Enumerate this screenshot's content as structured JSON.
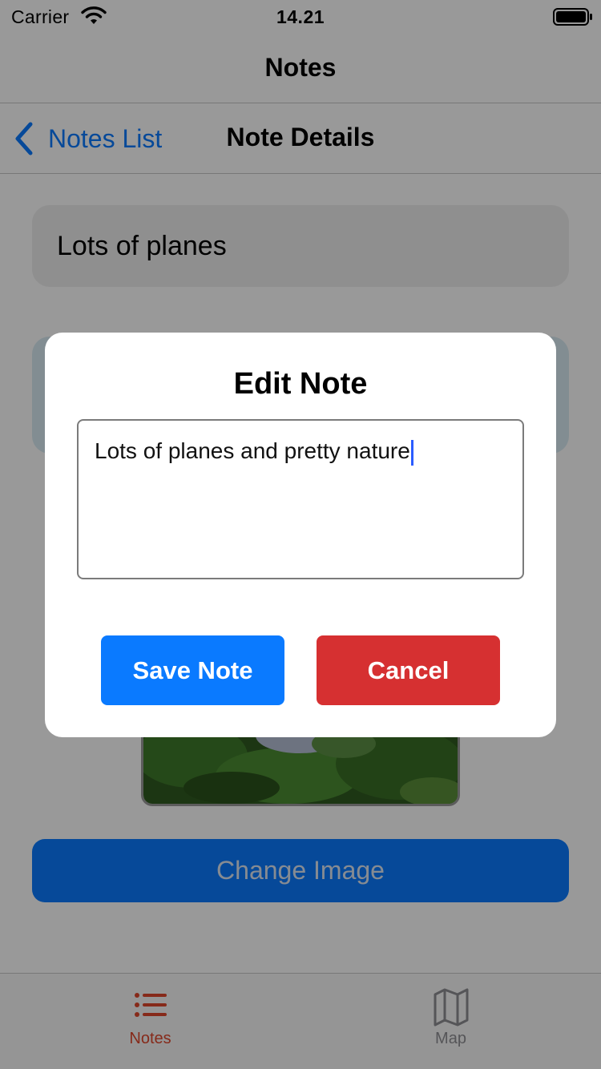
{
  "status_bar": {
    "carrier": "Carrier",
    "time": "14.21",
    "wifi_icon": "wifi-icon",
    "battery_icon": "battery-icon"
  },
  "app": {
    "title": "Notes"
  },
  "nav": {
    "back_label": "Notes List",
    "back_icon": "chevron-left-icon",
    "title": "Note Details"
  },
  "note": {
    "title": "Lots of planes"
  },
  "change_image_button": {
    "label": "Change Image"
  },
  "modal": {
    "title": "Edit Note",
    "text_value": "Lots of planes and pretty nature",
    "save_label": "Save Note",
    "cancel_label": "Cancel"
  },
  "tab_bar": {
    "tabs": [
      {
        "label": "Notes",
        "icon": "list-icon",
        "selected": true
      },
      {
        "label": "Map",
        "icon": "map-icon",
        "selected": false
      }
    ]
  },
  "colors": {
    "accent": "#0a7aff",
    "cancel": "#d63031",
    "tab_selected": "#e0472c",
    "tab_unselected": "#8e8e93"
  }
}
